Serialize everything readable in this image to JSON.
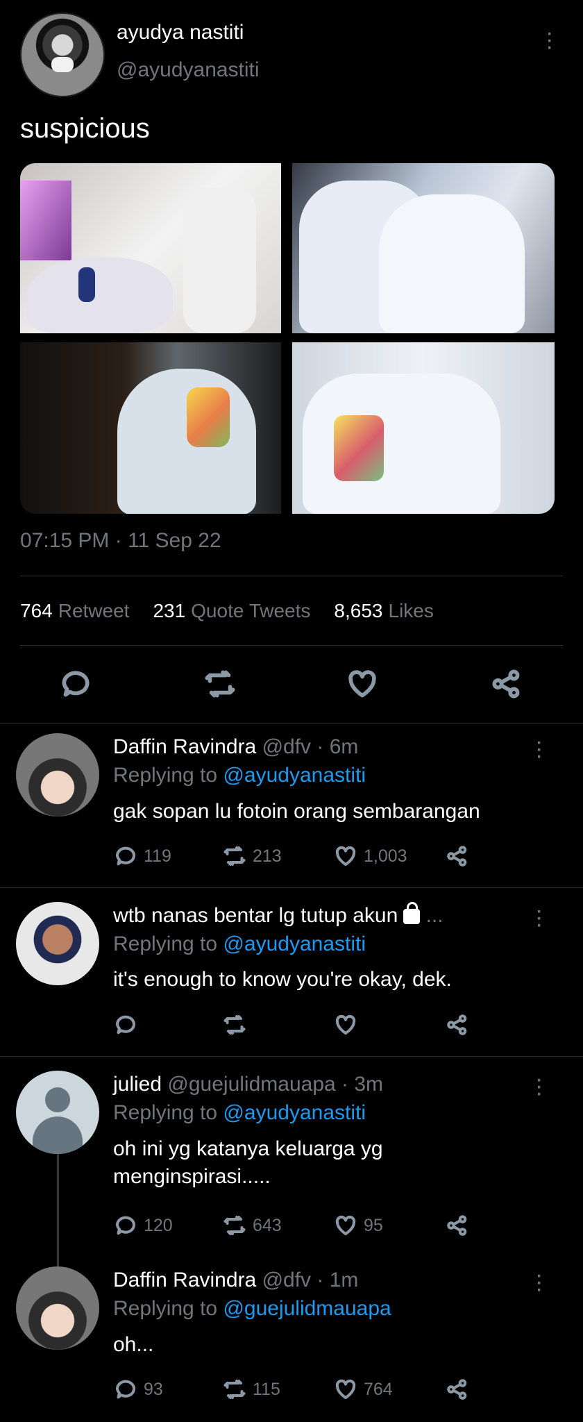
{
  "main_tweet": {
    "name": "ayudya nastiti",
    "handle": "@ayudyanastiti",
    "text": "suspicious",
    "time": "07:15 PM · 11 Sep 22",
    "stats": {
      "retweets_count": "764",
      "retweets_label": "Retweet",
      "quotes_count": "231",
      "quotes_label": "Quote Tweets",
      "likes_count": "8,653",
      "likes_label": "Likes"
    },
    "icons": [
      "reply-icon",
      "retweet-icon",
      "heart-icon",
      "share-icon"
    ]
  },
  "replies": [
    {
      "name": "Daffin Ravindra",
      "meta": " @dfv · 6m",
      "replying_prefix": "Replying to ",
      "replying_handle": "@ayudyanastiti",
      "text": "gak sopan lu fotoin orang sembarangan",
      "replies": "119",
      "retweets": "213",
      "likes": "1,003"
    },
    {
      "name": "wtb nanas bentar lg tutup akun",
      "meta": " ...",
      "replying_prefix": "Replying to ",
      "replying_handle": "@ayudyanastiti",
      "text": "it's enough to know you're okay, dek.",
      "replies": "",
      "retweets": "",
      "likes": ""
    },
    {
      "name": "julied",
      "meta": " @guejulidmauapa · 3m",
      "replying_prefix": "Replying to ",
      "replying_handle": "@ayudyanastiti",
      "text_line1": "oh ini yg katanya keluarga yg",
      "text_line2": "menginspirasi.....",
      "replies": "120",
      "retweets": "643",
      "likes": "95"
    },
    {
      "name": "Daffin Ravindra",
      "meta": " @dfv · 1m",
      "replying_prefix": "Replying to ",
      "replying_handle": "@guejulidmauapa",
      "text": "oh...",
      "replies": "93",
      "retweets": "115",
      "likes": "764"
    }
  ]
}
